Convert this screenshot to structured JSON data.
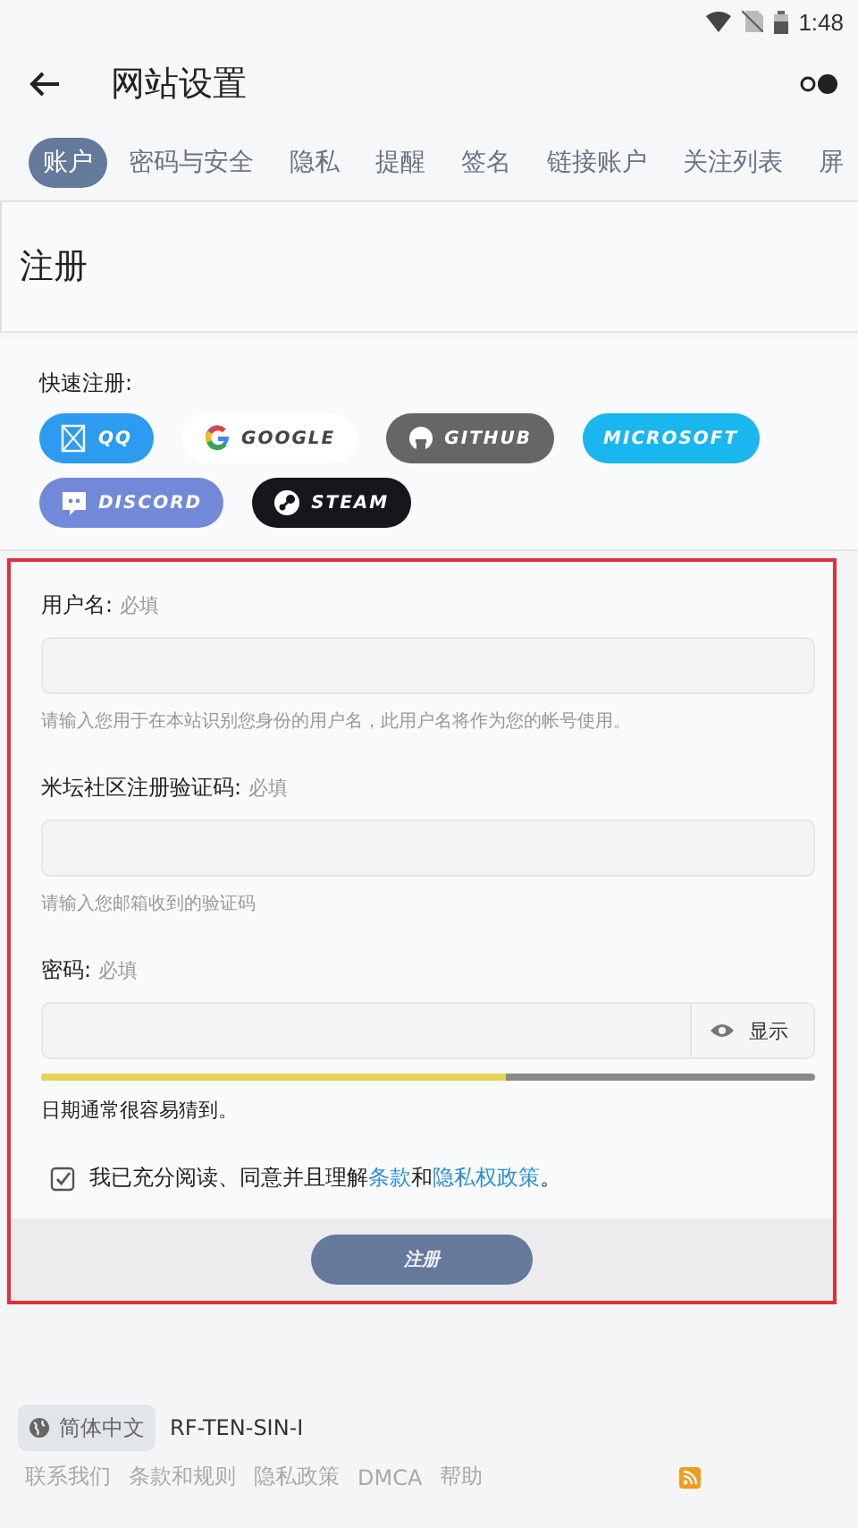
{
  "status_bar": {
    "time": "1:48"
  },
  "app_bar": {
    "title": "网站设置"
  },
  "tabs": [
    {
      "label": "账户",
      "selected": true
    },
    {
      "label": "密码与安全",
      "selected": false
    },
    {
      "label": "隐私",
      "selected": false
    },
    {
      "label": "提醒",
      "selected": false
    },
    {
      "label": "签名",
      "selected": false
    },
    {
      "label": "链接账户",
      "selected": false
    },
    {
      "label": "关注列表",
      "selected": false
    },
    {
      "label": "屏",
      "selected": false
    }
  ],
  "page_title": "注册",
  "quick_register": {
    "label": "快速注册:",
    "providers": [
      {
        "kind": "qq",
        "label": "QQ",
        "color": "#2d9cf0"
      },
      {
        "kind": "google",
        "label": "GOOGLE",
        "color": "#ffffff"
      },
      {
        "kind": "github",
        "label": "GITHUB",
        "color": "#666666"
      },
      {
        "kind": "microsoft",
        "label": "MICROSOFT",
        "color": "#1ab6ee"
      },
      {
        "kind": "discord",
        "label": "DISCORD",
        "color": "#7289da"
      },
      {
        "kind": "steam",
        "label": "STEAM",
        "color": "#15171d"
      }
    ]
  },
  "form": {
    "fields": [
      {
        "kind": "text",
        "label": "用户名:",
        "required": "必填",
        "hint": "请输入您用于在本站识别您身份的用户名，此用户名将作为您的帐号使用。"
      },
      {
        "kind": "text",
        "label": "米坛社区注册验证码:",
        "required": "必填",
        "hint": "请输入您邮箱收到的验证码"
      },
      {
        "kind": "password",
        "label": "密码:",
        "required": "必填",
        "toggle": "显示",
        "strength": {
          "level": 0.6
        },
        "hint": "日期通常很容易猜到。"
      }
    ],
    "agreement": {
      "checked": true,
      "text": "我已充分阅读、同意并且理解",
      "link1": "条款",
      "middle": "和",
      "link2": "隐私权政策",
      "end": "。"
    },
    "submit": "注册"
  },
  "footer": {
    "language": "简体中文",
    "code": "RF-TEN-SIN-I",
    "links": [
      "联系我们",
      "条款和规则",
      "隐私政策",
      "DMCA",
      "帮助"
    ]
  }
}
